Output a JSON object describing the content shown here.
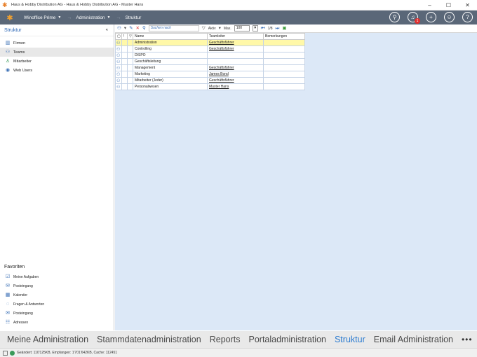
{
  "window": {
    "title": "Haus & Hobby Distribution AG - Haus & Hobby Distribution AG - Muster Hans",
    "minimize": "–",
    "maximize": "☐",
    "close": "✕"
  },
  "navbar": {
    "app_menu": "Winoffice Prime",
    "module_menu": "Administration",
    "current": "Struktur",
    "notification_count": "1"
  },
  "sidebar": {
    "title": "Struktur",
    "collapse": "«",
    "items": [
      {
        "label": "Firmen",
        "icon": "building-icon"
      },
      {
        "label": "Teams",
        "icon": "team-icon"
      },
      {
        "label": "Mitarbeiter",
        "icon": "person-icon"
      },
      {
        "label": "Web Users",
        "icon": "globe-user-icon"
      }
    ],
    "favorites_title": "Favoriten",
    "favorites": [
      {
        "label": "Meine Aufgaben"
      },
      {
        "label": "Posteingang"
      },
      {
        "label": "Kalender"
      },
      {
        "label": "Fragen & Antworten"
      },
      {
        "label": "Posteingang"
      },
      {
        "label": "Adressen"
      }
    ]
  },
  "toolbar": {
    "search_placeholder": "Suchen nach",
    "filter_label": "Aktiv",
    "max_label": "Max.",
    "max_value": "100",
    "page_info": "1/8"
  },
  "grid": {
    "headers": [
      "Name",
      "Teamleiter",
      "Bemerkungen"
    ],
    "rows": [
      {
        "name": "Administration",
        "leader": "Geschäftsführer",
        "note": ""
      },
      {
        "name": "Controlling",
        "leader": "Geschäftsführer",
        "note": ""
      },
      {
        "name": "DISPO",
        "leader": "",
        "note": ""
      },
      {
        "name": "Geschäftsleitung",
        "leader": "",
        "note": ""
      },
      {
        "name": "Management",
        "leader": "Geschäftsführer",
        "note": ""
      },
      {
        "name": "Marketing",
        "leader": "James Bond",
        "note": ""
      },
      {
        "name": "Mitarbeiter (Jeder)",
        "leader": "Geschäftsführer",
        "note": ""
      },
      {
        "name": "Personalwesen",
        "leader": "Muster Hans",
        "note": ""
      }
    ]
  },
  "tabs": [
    {
      "label": "Meine Administration"
    },
    {
      "label": "Stammdatenadministration"
    },
    {
      "label": "Reports"
    },
    {
      "label": "Portaladministration"
    },
    {
      "label": "Struktur"
    },
    {
      "label": "Email Administration"
    }
  ],
  "tabs_more": "•••",
  "status": {
    "text": "Geändert: 110'125KB, Empfangen: 1'701'642KB, Cache: 112451"
  },
  "colors": {
    "navbar": "#5a6778",
    "accent": "#2b7bd0",
    "selection": "#fff8a8",
    "grid_background": "#dce8f7"
  }
}
